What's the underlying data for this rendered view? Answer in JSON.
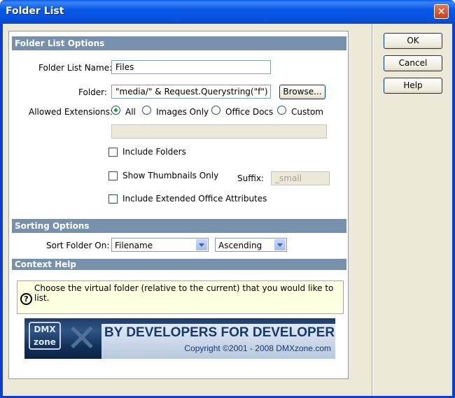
{
  "window": {
    "title": "Folder List",
    "close_glyph": "✕"
  },
  "buttons": {
    "ok": "OK",
    "cancel": "Cancel",
    "help": "Help",
    "browse": "Browse..."
  },
  "folder_list_options": {
    "header": "Folder List Options",
    "name_label": "Folder List Name:",
    "name_value": "Files",
    "folder_label": "Folder:",
    "folder_value": "\"media/\" & Request.Querystring(\"f\")",
    "extensions_label": "Allowed Extensions:",
    "extensions": [
      {
        "label": "All",
        "checked": true
      },
      {
        "label": "Images Only",
        "checked": false
      },
      {
        "label": "Office Docs",
        "checked": false
      },
      {
        "label": "Custom",
        "checked": false
      }
    ],
    "custom_extensions_value": "",
    "include_folders": {
      "label": "Include Folders",
      "checked": false
    },
    "show_thumbnails": {
      "label": "Show Thumbnails Only",
      "checked": false
    },
    "suffix_label": "Suffix:",
    "suffix_value": "_small",
    "include_extended": {
      "label": "Include Extended Office Attributes",
      "checked": false
    }
  },
  "sorting_options": {
    "header": "Sorting Options",
    "sort_label": "Sort Folder On:",
    "sort_field": "Filename",
    "sort_order": "Ascending"
  },
  "context_help": {
    "header": "Context Help",
    "icon_glyph": "?",
    "text": "Choose the virtual folder (relative to the current) that you would like to list."
  },
  "banner": {
    "logo_line1": "DMX",
    "logo_line2": "zone",
    "slogan": "BY DEVELOPERS FOR DEVELOPERS",
    "copyright": "Copyright ©2001 - 2008 DMXzone.com"
  },
  "colors": {
    "title_bar": "#0552dd",
    "section_header": "#7791ad",
    "help_background": "#ffffe1",
    "dialog_background": "#ece9d8"
  }
}
